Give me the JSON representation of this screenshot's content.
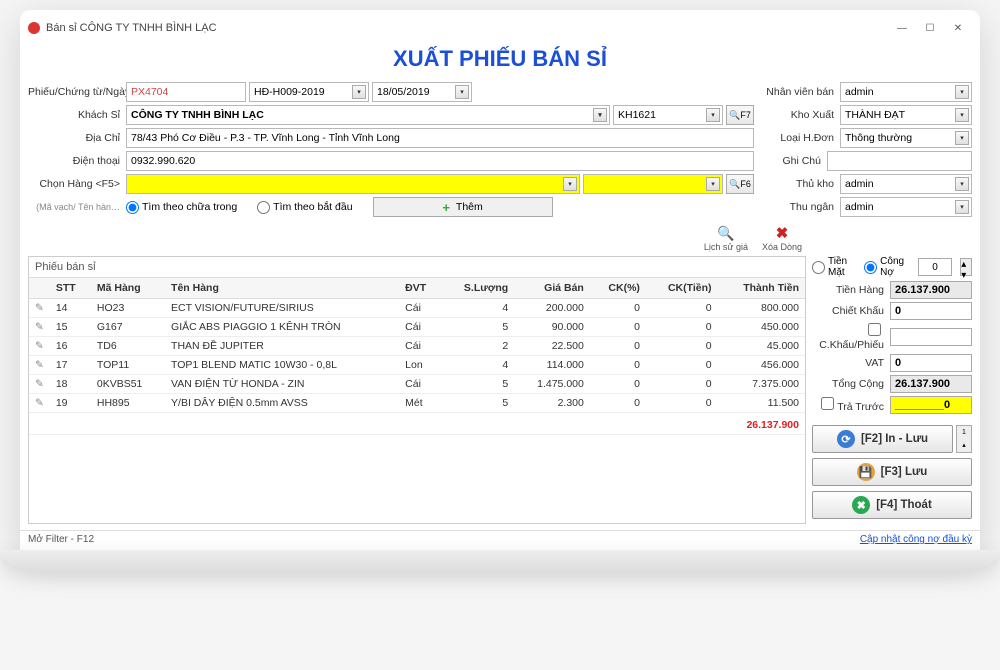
{
  "window": {
    "title": "Bán sỉ CÔNG TY TNHH BÌNH LẠC"
  },
  "page_title": "XUẤT PHIẾU BÁN SỈ",
  "labels": {
    "receipt": "Phiếu/Chứng từ/Ngày",
    "customer": "Khách Sỉ",
    "address": "Địa Chỉ",
    "phone": "Điện thoại",
    "pick": "Chọn Hàng <F5>",
    "searchhint": "(Mã vạch/ Tên hàn…",
    "radio1": "Tìm theo chữa trong",
    "radio2": "Tìm theo bắt đầu",
    "add": "Thêm",
    "staff": "Nhân viên bán",
    "warehouse": "Kho Xuất",
    "invtype": "Loại H.Đơn",
    "note": "Ghi Chú",
    "storekeeper": "Thủ kho",
    "cashier": "Thu ngân",
    "history": "Lịch sử giá",
    "delrow": "Xóa Dòng",
    "cash": "Tiền Mặt",
    "debt": "Công Nợ",
    "subtotal": "Tiền Hàng",
    "discount": "Chiết Khấu",
    "discount_per": "C.Khấu/Phiếu",
    "vat": "VAT",
    "grand": "Tổng Cộng",
    "prepay": "Trả Trước",
    "btn_print": "[F2] In - Lưu",
    "btn_save": "[F3] Lưu",
    "btn_exit": "[F4] Thoát",
    "one": "1",
    "footer_left": "Mở Filter - F12",
    "footer_right": "Cập nhật công nợ đầu kỳ"
  },
  "form": {
    "receipt_no": "PX4704",
    "receipt_series": "HĐ-H009-2019",
    "receipt_date": "18/05/2019",
    "customer_name": "CÔNG TY TNHH BÌNH LẠC",
    "customer_code": "KH1621",
    "f7": "F7",
    "f6": "F6",
    "address": "78/43 Phó Cơ Điều - P.3 - TP. Vĩnh Long - Tỉnh Vĩnh Long",
    "phone": "0932.990.620",
    "staff": "admin",
    "warehouse": "THÀNH ĐẠT",
    "invtype": "Thông thường",
    "note": "",
    "storekeeper": "admin",
    "cashier": "admin",
    "debt_count": "0"
  },
  "table": {
    "title": "Phiếu bán sỉ",
    "headers": {
      "stt": "STT",
      "code": "Mã Hàng",
      "name": "Tên Hàng",
      "unit": "ĐVT",
      "qty": "S.Lượng",
      "price": "Giá Bán",
      "ckp": "CK(%)",
      "ckt": "CK(Tiền)",
      "total": "Thành Tiền"
    },
    "rows": [
      {
        "stt": "14",
        "code": "HO23",
        "name": "ECT VISION/FUTURE/SIRIUS",
        "unit": "Cái",
        "qty": "4",
        "price": "200.000",
        "ckp": "0",
        "ckt": "0",
        "total": "800.000"
      },
      {
        "stt": "15",
        "code": "G167",
        "name": "GIẮC ABS PIAGGIO 1 KÊNH TRÒN",
        "unit": "Cái",
        "qty": "5",
        "price": "90.000",
        "ckp": "0",
        "ckt": "0",
        "total": "450.000"
      },
      {
        "stt": "16",
        "code": "TD6",
        "name": "THAN ĐỀ JUPITER",
        "unit": "Cái",
        "qty": "2",
        "price": "22.500",
        "ckp": "0",
        "ckt": "0",
        "total": "45.000"
      },
      {
        "stt": "17",
        "code": "TOP11",
        "name": "TOP1 BLEND MATIC 10W30 - 0,8L",
        "unit": "Lon",
        "qty": "4",
        "price": "114.000",
        "ckp": "0",
        "ckt": "0",
        "total": "456.000"
      },
      {
        "stt": "18",
        "code": "0KVBS51",
        "name": "VAN ĐIỆN TỪ HONDA - ZIN",
        "unit": "Cái",
        "qty": "5",
        "price": "1.475.000",
        "ckp": "0",
        "ckt": "0",
        "total": "7.375.000"
      },
      {
        "stt": "19",
        "code": "HH895",
        "name": "Y/BI DÂY ĐIỆN  0.5mm AVSS",
        "unit": "Mét",
        "qty": "5",
        "price": "2.300",
        "ckp": "0",
        "ckt": "0",
        "total": "11.500"
      }
    ],
    "grand_total": "26.137.900"
  },
  "summary": {
    "subtotal": "26.137.900",
    "discount": "0",
    "discount_per": "",
    "vat": "0",
    "grand": "26.137.900",
    "prepay": "________0"
  }
}
